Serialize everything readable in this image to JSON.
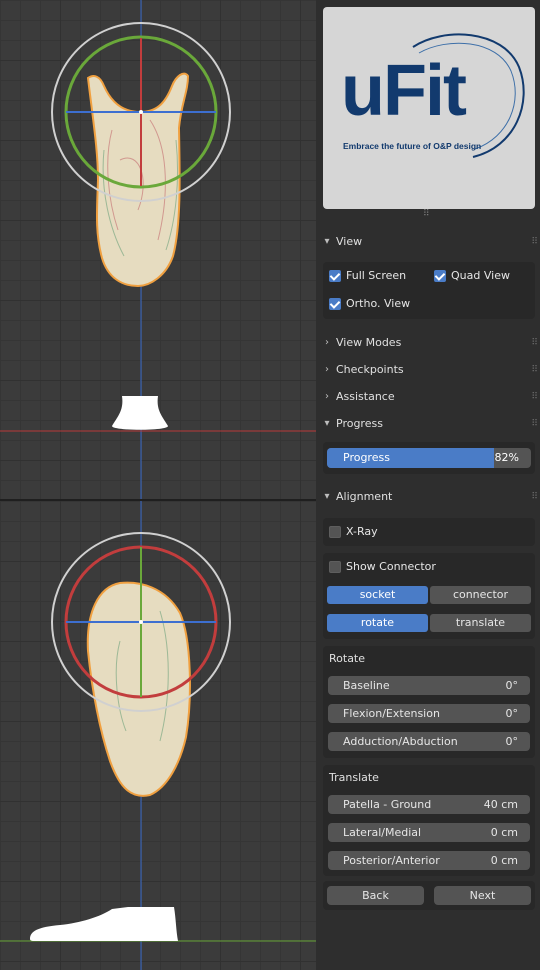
{
  "viewport": {
    "accent_colors": {
      "x_axis": "#c23d3d",
      "y_axis": "#6aa83a",
      "z_axis": "#3d6fd0",
      "selection": "#f0a040"
    }
  },
  "logo": {
    "text": "uFit",
    "tagline": "Embrace the future of O&P design",
    "color": "#123a6e"
  },
  "view": {
    "title": "View",
    "full_screen": {
      "label": "Full Screen",
      "checked": true
    },
    "quad_view": {
      "label": "Quad View",
      "checked": true
    },
    "ortho_view": {
      "label": "Ortho. View",
      "checked": true
    }
  },
  "collapsed_panels": {
    "view_modes": "View Modes",
    "checkpoints": "Checkpoints",
    "assistance": "Assistance"
  },
  "progress": {
    "title": "Progress",
    "label": "Progress",
    "value_text": "82%",
    "value": 0.82
  },
  "alignment": {
    "title": "Alignment",
    "xray": {
      "label": "X-Ray",
      "checked": false
    },
    "show_connector": {
      "label": "Show Connector",
      "checked": false
    },
    "target_tabs": [
      "socket",
      "connector"
    ],
    "mode_tabs": [
      "rotate",
      "translate"
    ],
    "rotate": {
      "title": "Rotate",
      "fields": [
        {
          "label": "Baseline",
          "value": "0°"
        },
        {
          "label": "Flexion/Extension",
          "value": "0°"
        },
        {
          "label": "Adduction/Abduction",
          "value": "0°"
        }
      ]
    },
    "translate": {
      "title": "Translate",
      "fields": [
        {
          "label": "Patella - Ground",
          "value": "40 cm"
        },
        {
          "label": "Lateral/Medial",
          "value": "0 cm"
        },
        {
          "label": "Posterior/Anterior",
          "value": "0 cm"
        }
      ]
    },
    "back_label": "Back",
    "next_label": "Next"
  },
  "icons": {
    "expanded": "chevron-down-icon",
    "collapsed": "chevron-right-icon",
    "drag": "drag-handle-icon"
  }
}
